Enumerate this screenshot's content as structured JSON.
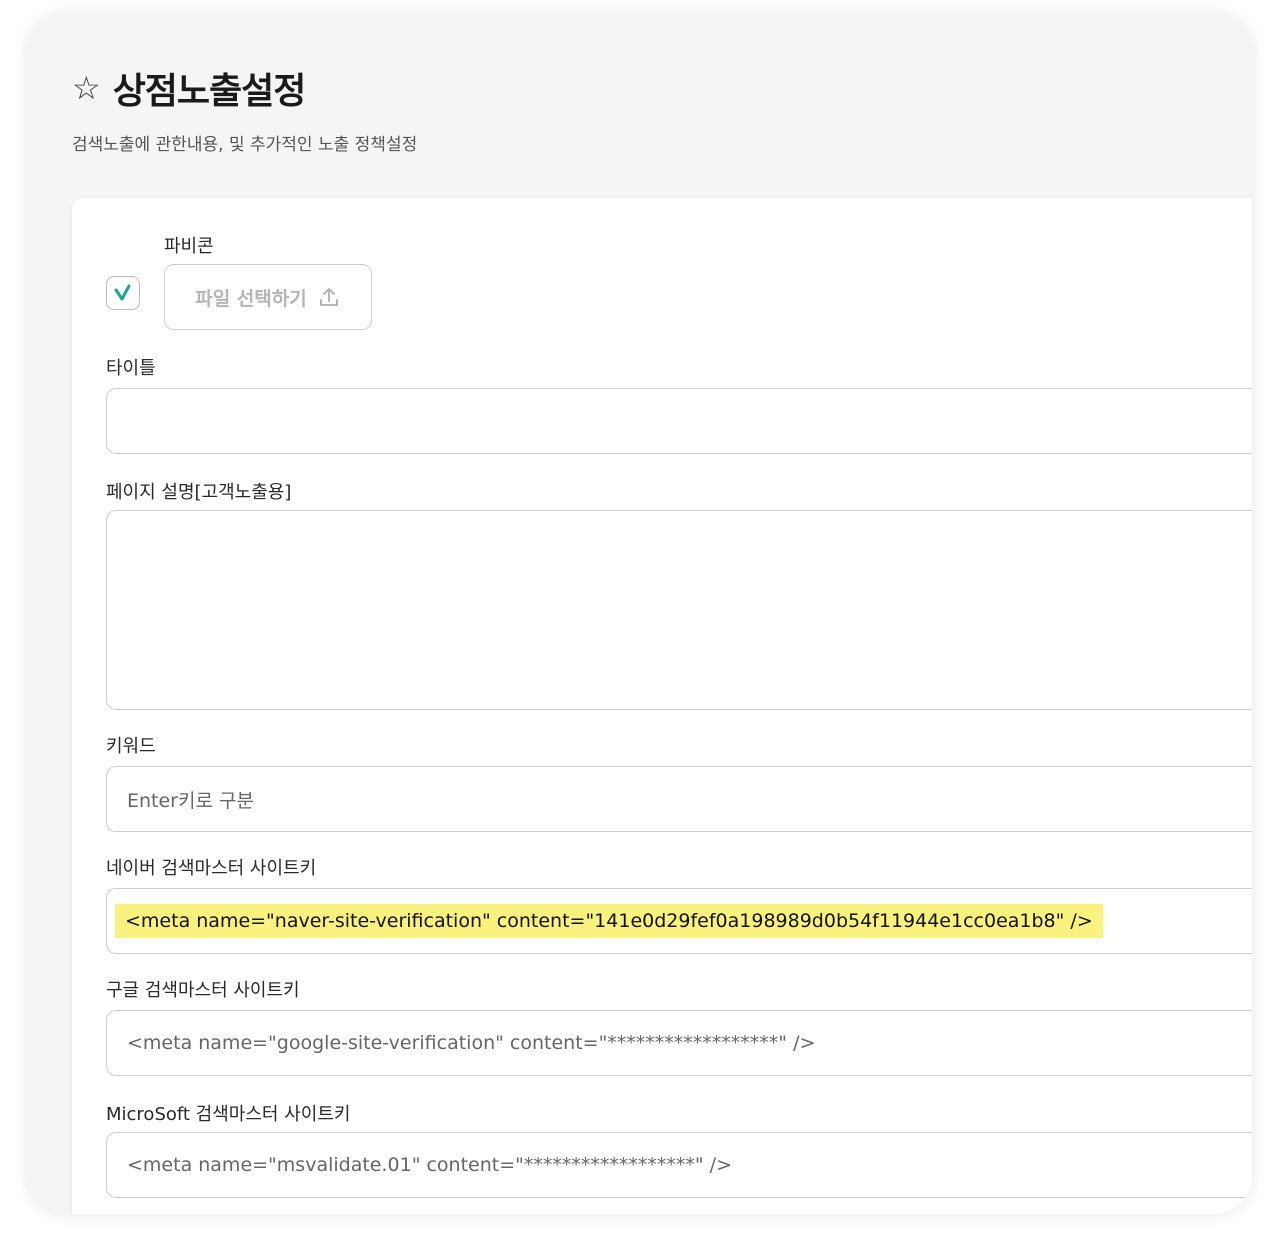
{
  "header": {
    "title": "상점노출설정",
    "subtitle": "검색노출에 관한내용, 및 추가적인 노출 정책설정",
    "star_icon": "star-outline-icon"
  },
  "form": {
    "favicon": {
      "label": "파비콘",
      "checked": true,
      "check_color": "#1aa59a",
      "file_button": "파일 선택하기",
      "upload_icon": "upload-icon"
    },
    "title": {
      "label": "타이틀",
      "value": ""
    },
    "description": {
      "label": "페이지 설명[고객노출용]",
      "value": ""
    },
    "keywords": {
      "label": "키워드",
      "placeholder": "Enter키로 구분"
    },
    "naver": {
      "label": "네이버 검색마스터 사이트키",
      "value": "<meta name=\"naver-site-verification\" content=\"141e0d29fef0a198989d0b54f11944e1cc0ea1b8\" />",
      "highlight_color": "#fbf27e"
    },
    "google": {
      "label": "구글 검색마스터 사이트키",
      "placeholder": "<meta name=\"google-site-verification\" content=\"******************\" />"
    },
    "microsoft": {
      "label": "MicroSoft 검색마스터 사이트키",
      "placeholder": "<meta name=\"msvalidate.01\" content=\"******************\" />"
    }
  }
}
